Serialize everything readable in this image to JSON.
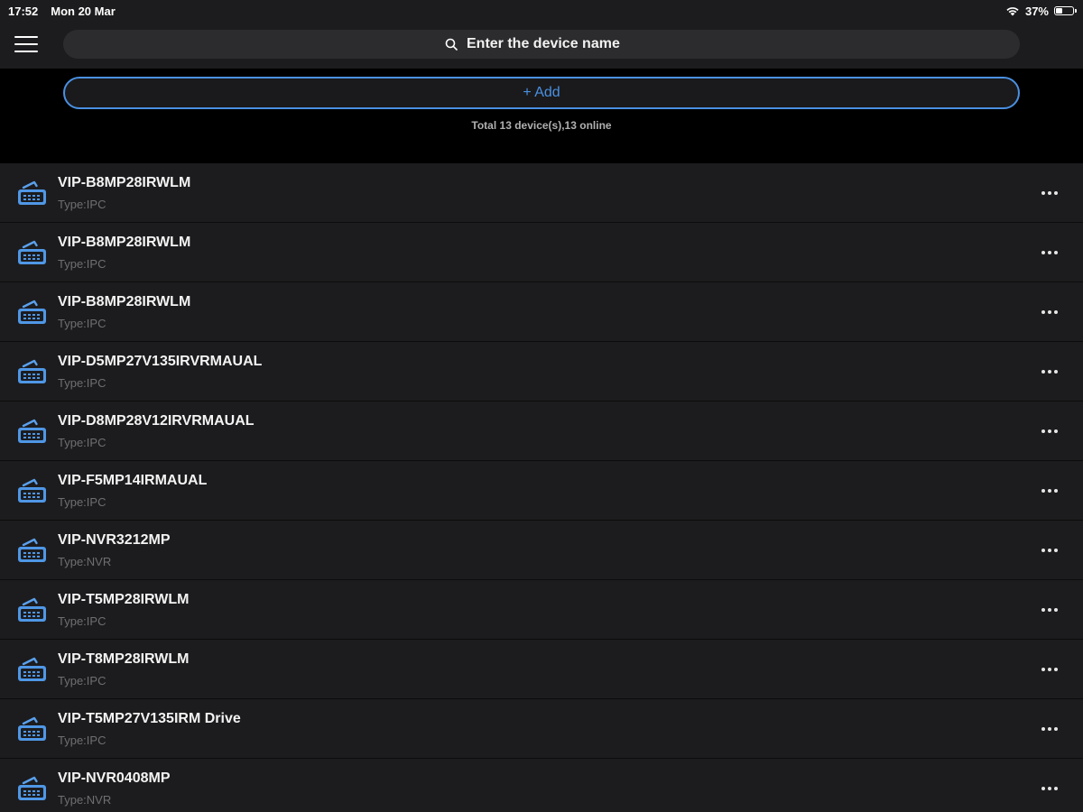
{
  "status_bar": {
    "time": "17:52",
    "date": "Mon 20 Mar",
    "battery_text": "37%",
    "battery_level": 0.37
  },
  "search": {
    "placeholder": "Enter the device name",
    "value": ""
  },
  "add_button": {
    "label": "+ Add"
  },
  "summary": {
    "text": "Total 13 device(s),13 online"
  },
  "colors": {
    "accent": "#4a90e2",
    "background": "#000000",
    "row_background": "#1c1c1e",
    "type_text": "#6f6f73"
  },
  "devices": [
    {
      "name": "VIP-B8MP28IRWLM",
      "type": "Type:IPC",
      "icon": "camera-device-icon"
    },
    {
      "name": "VIP-B8MP28IRWLM",
      "type": "Type:IPC",
      "icon": "camera-device-icon"
    },
    {
      "name": "VIP-B8MP28IRWLM",
      "type": "Type:IPC",
      "icon": "camera-device-icon"
    },
    {
      "name": "VIP-D5MP27V135IRVRMAUAL",
      "type": "Type:IPC",
      "icon": "camera-device-icon"
    },
    {
      "name": "VIP-D8MP28V12IRVRMAUAL",
      "type": "Type:IPC",
      "icon": "camera-device-icon"
    },
    {
      "name": "VIP-F5MP14IRMAUAL",
      "type": "Type:IPC",
      "icon": "camera-device-icon"
    },
    {
      "name": "VIP-NVR3212MP",
      "type": "Type:NVR",
      "icon": "camera-device-icon"
    },
    {
      "name": "VIP-T5MP28IRWLM",
      "type": "Type:IPC",
      "icon": "camera-device-icon"
    },
    {
      "name": "VIP-T8MP28IRWLM",
      "type": "Type:IPC",
      "icon": "camera-device-icon"
    },
    {
      "name": "VIP-T5MP27V135IRM Drive",
      "type": "Type:IPC",
      "icon": "camera-device-icon"
    },
    {
      "name": "VIP-NVR0408MP",
      "type": "Type:NVR",
      "icon": "camera-device-icon"
    }
  ]
}
